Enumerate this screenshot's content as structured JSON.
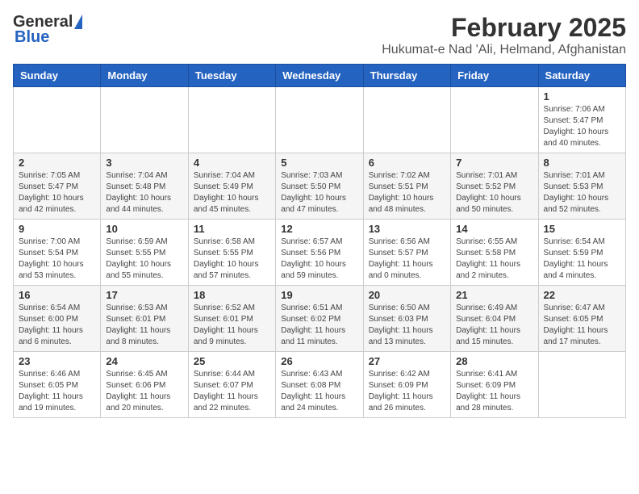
{
  "logo": {
    "general": "General",
    "blue": "Blue"
  },
  "header": {
    "month": "February 2025",
    "location": "Hukumat-e Nad 'Ali, Helmand, Afghanistan"
  },
  "weekdays": [
    "Sunday",
    "Monday",
    "Tuesday",
    "Wednesday",
    "Thursday",
    "Friday",
    "Saturday"
  ],
  "weeks": [
    [
      {
        "day": "",
        "info": ""
      },
      {
        "day": "",
        "info": ""
      },
      {
        "day": "",
        "info": ""
      },
      {
        "day": "",
        "info": ""
      },
      {
        "day": "",
        "info": ""
      },
      {
        "day": "",
        "info": ""
      },
      {
        "day": "1",
        "info": "Sunrise: 7:06 AM\nSunset: 5:47 PM\nDaylight: 10 hours\nand 40 minutes."
      }
    ],
    [
      {
        "day": "2",
        "info": "Sunrise: 7:05 AM\nSunset: 5:47 PM\nDaylight: 10 hours\nand 42 minutes."
      },
      {
        "day": "3",
        "info": "Sunrise: 7:04 AM\nSunset: 5:48 PM\nDaylight: 10 hours\nand 44 minutes."
      },
      {
        "day": "4",
        "info": "Sunrise: 7:04 AM\nSunset: 5:49 PM\nDaylight: 10 hours\nand 45 minutes."
      },
      {
        "day": "5",
        "info": "Sunrise: 7:03 AM\nSunset: 5:50 PM\nDaylight: 10 hours\nand 47 minutes."
      },
      {
        "day": "6",
        "info": "Sunrise: 7:02 AM\nSunset: 5:51 PM\nDaylight: 10 hours\nand 48 minutes."
      },
      {
        "day": "7",
        "info": "Sunrise: 7:01 AM\nSunset: 5:52 PM\nDaylight: 10 hours\nand 50 minutes."
      },
      {
        "day": "8",
        "info": "Sunrise: 7:01 AM\nSunset: 5:53 PM\nDaylight: 10 hours\nand 52 minutes."
      }
    ],
    [
      {
        "day": "9",
        "info": "Sunrise: 7:00 AM\nSunset: 5:54 PM\nDaylight: 10 hours\nand 53 minutes."
      },
      {
        "day": "10",
        "info": "Sunrise: 6:59 AM\nSunset: 5:55 PM\nDaylight: 10 hours\nand 55 minutes."
      },
      {
        "day": "11",
        "info": "Sunrise: 6:58 AM\nSunset: 5:55 PM\nDaylight: 10 hours\nand 57 minutes."
      },
      {
        "day": "12",
        "info": "Sunrise: 6:57 AM\nSunset: 5:56 PM\nDaylight: 10 hours\nand 59 minutes."
      },
      {
        "day": "13",
        "info": "Sunrise: 6:56 AM\nSunset: 5:57 PM\nDaylight: 11 hours\nand 0 minutes."
      },
      {
        "day": "14",
        "info": "Sunrise: 6:55 AM\nSunset: 5:58 PM\nDaylight: 11 hours\nand 2 minutes."
      },
      {
        "day": "15",
        "info": "Sunrise: 6:54 AM\nSunset: 5:59 PM\nDaylight: 11 hours\nand 4 minutes."
      }
    ],
    [
      {
        "day": "16",
        "info": "Sunrise: 6:54 AM\nSunset: 6:00 PM\nDaylight: 11 hours\nand 6 minutes."
      },
      {
        "day": "17",
        "info": "Sunrise: 6:53 AM\nSunset: 6:01 PM\nDaylight: 11 hours\nand 8 minutes."
      },
      {
        "day": "18",
        "info": "Sunrise: 6:52 AM\nSunset: 6:01 PM\nDaylight: 11 hours\nand 9 minutes."
      },
      {
        "day": "19",
        "info": "Sunrise: 6:51 AM\nSunset: 6:02 PM\nDaylight: 11 hours\nand 11 minutes."
      },
      {
        "day": "20",
        "info": "Sunrise: 6:50 AM\nSunset: 6:03 PM\nDaylight: 11 hours\nand 13 minutes."
      },
      {
        "day": "21",
        "info": "Sunrise: 6:49 AM\nSunset: 6:04 PM\nDaylight: 11 hours\nand 15 minutes."
      },
      {
        "day": "22",
        "info": "Sunrise: 6:47 AM\nSunset: 6:05 PM\nDaylight: 11 hours\nand 17 minutes."
      }
    ],
    [
      {
        "day": "23",
        "info": "Sunrise: 6:46 AM\nSunset: 6:05 PM\nDaylight: 11 hours\nand 19 minutes."
      },
      {
        "day": "24",
        "info": "Sunrise: 6:45 AM\nSunset: 6:06 PM\nDaylight: 11 hours\nand 20 minutes."
      },
      {
        "day": "25",
        "info": "Sunrise: 6:44 AM\nSunset: 6:07 PM\nDaylight: 11 hours\nand 22 minutes."
      },
      {
        "day": "26",
        "info": "Sunrise: 6:43 AM\nSunset: 6:08 PM\nDaylight: 11 hours\nand 24 minutes."
      },
      {
        "day": "27",
        "info": "Sunrise: 6:42 AM\nSunset: 6:09 PM\nDaylight: 11 hours\nand 26 minutes."
      },
      {
        "day": "28",
        "info": "Sunrise: 6:41 AM\nSunset: 6:09 PM\nDaylight: 11 hours\nand 28 minutes."
      },
      {
        "day": "",
        "info": ""
      }
    ]
  ]
}
